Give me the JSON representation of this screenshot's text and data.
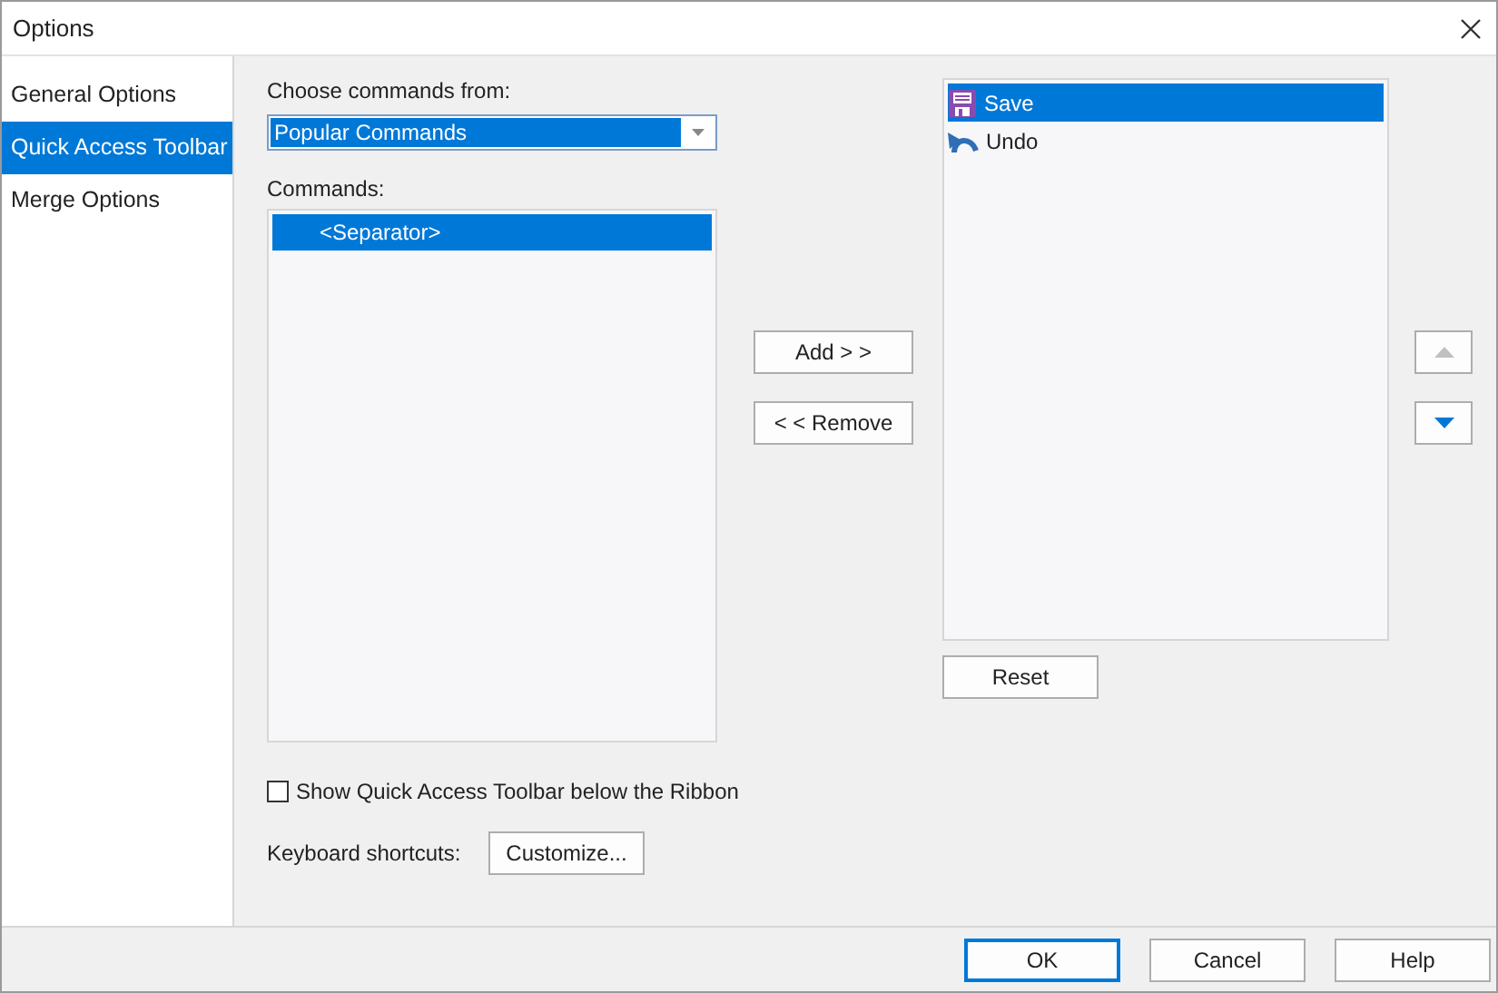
{
  "window": {
    "title": "Options"
  },
  "sidebar": {
    "items": [
      {
        "label": "General Options",
        "selected": false
      },
      {
        "label": "Quick Access Toolbar",
        "selected": true
      },
      {
        "label": "Merge Options",
        "selected": false
      }
    ]
  },
  "source": {
    "label": "Choose commands from:",
    "value": "Popular Commands"
  },
  "commands": {
    "label": "Commands:",
    "items": [
      {
        "label": "<Separator>",
        "selected": true
      }
    ]
  },
  "add_button": "Add > >",
  "remove_button": "< < Remove",
  "toolbar_items": [
    {
      "label": "Save",
      "kind": "save",
      "selected": true
    },
    {
      "label": "Undo",
      "kind": "undo",
      "selected": false
    }
  ],
  "reset_button": "Reset",
  "move_up": {
    "disabled": true
  },
  "move_down": {
    "disabled": false
  },
  "below_ribbon": {
    "label": "Show Quick Access Toolbar below the Ribbon",
    "checked": false
  },
  "shortcuts": {
    "label": "Keyboard shortcuts:",
    "button": "Customize..."
  },
  "buttons": [
    {
      "label": "OK",
      "default": true
    },
    {
      "label": "Cancel",
      "default": false
    },
    {
      "label": "Help",
      "default": false
    }
  ]
}
